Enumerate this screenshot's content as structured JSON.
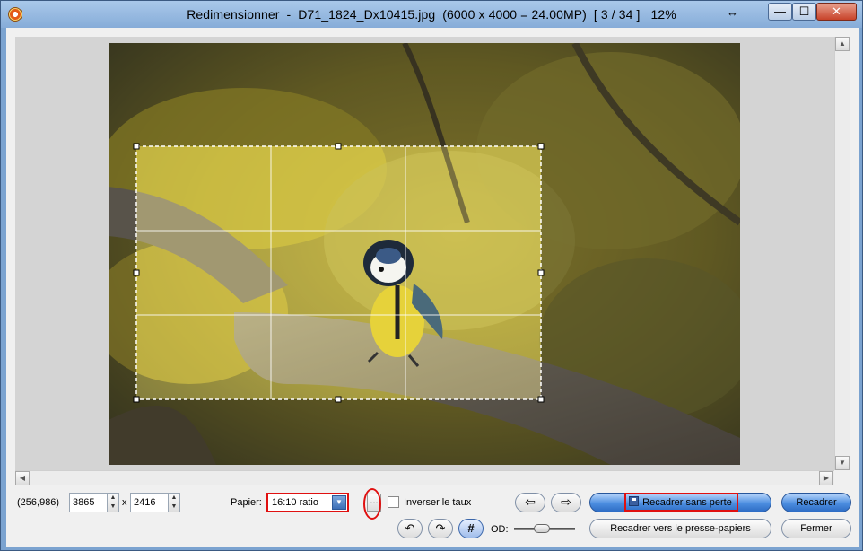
{
  "window": {
    "title": "Redimensionner  -  D71_1824_Dx10415.jpg  (6000 x 4000 = 24.00MP)  [ 3 / 34 ]   12%",
    "resize_glyph": "↔",
    "minimize_glyph": "—",
    "maximize_glyph": "☐",
    "close_glyph": "✕"
  },
  "icons": {
    "app": "app-icon",
    "scroll_up": "▲",
    "scroll_down": "▼",
    "scroll_left": "◀",
    "scroll_right": "▶",
    "spin_up": "▲",
    "spin_down": "▼",
    "combo_arrow": "▼",
    "prev": "⇦",
    "next": "⇨",
    "rotate_left": "↶",
    "rotate_right": "↷",
    "grid": "#"
  },
  "toolbar": {
    "coords": "(256,986)",
    "width_value": "3865",
    "times": "x",
    "height_value": "2416",
    "paper_label": "Papier:",
    "paper_value": "16:10 ratio",
    "dots_label": "...",
    "invert_label": "Inverser le taux",
    "od_label": "OD:",
    "lossless_crop": "Recadrer sans perte",
    "crop": "Recadrer",
    "crop_clipboard": "Recadrer vers le presse-papiers",
    "close": "Fermer"
  },
  "colors": {
    "highlight_red": "#e01010",
    "accent_blue": "#2e6cc4"
  }
}
